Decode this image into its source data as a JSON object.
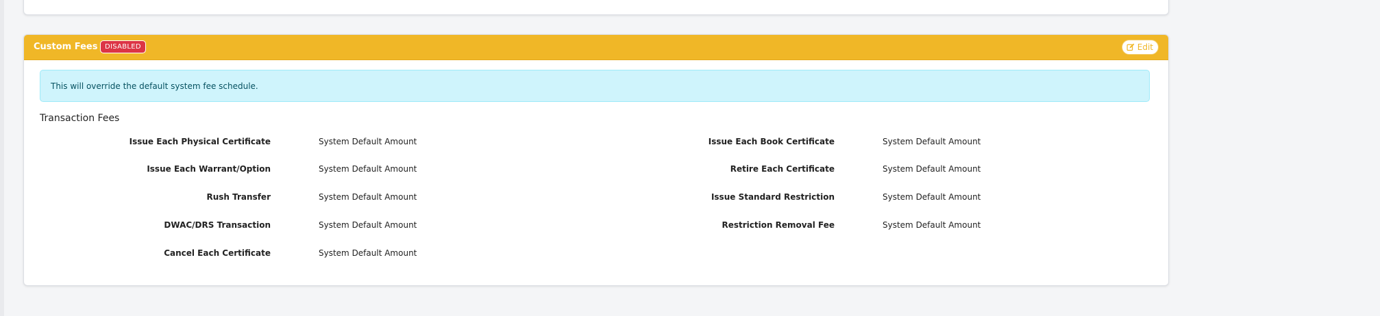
{
  "card": {
    "title": "Custom Fees",
    "status_badge": "DISABLED",
    "edit_label": "Edit",
    "header_color": "#f0b727",
    "badge_color": "#dc3545"
  },
  "info": {
    "message": "This will override the default system fee schedule."
  },
  "section": {
    "title": "Transaction Fees"
  },
  "fees_left": [
    {
      "label": "Issue Each Physical Certificate",
      "value": "System Default Amount"
    },
    {
      "label": "Issue Each Warrant/Option",
      "value": "System Default Amount"
    },
    {
      "label": "Rush Transfer",
      "value": "System Default Amount"
    },
    {
      "label": "DWAC/DRS Transaction",
      "value": "System Default Amount"
    },
    {
      "label": "Cancel Each Certificate",
      "value": "System Default Amount"
    }
  ],
  "fees_right": [
    {
      "label": "Issue Each Book Certificate",
      "value": "System Default Amount"
    },
    {
      "label": "Retire Each Certificate",
      "value": "System Default Amount"
    },
    {
      "label": "Issue Standard Restriction",
      "value": "System Default Amount"
    },
    {
      "label": "Restriction Removal Fee",
      "value": "System Default Amount"
    }
  ],
  "icons": {
    "edit": "edit-icon"
  }
}
